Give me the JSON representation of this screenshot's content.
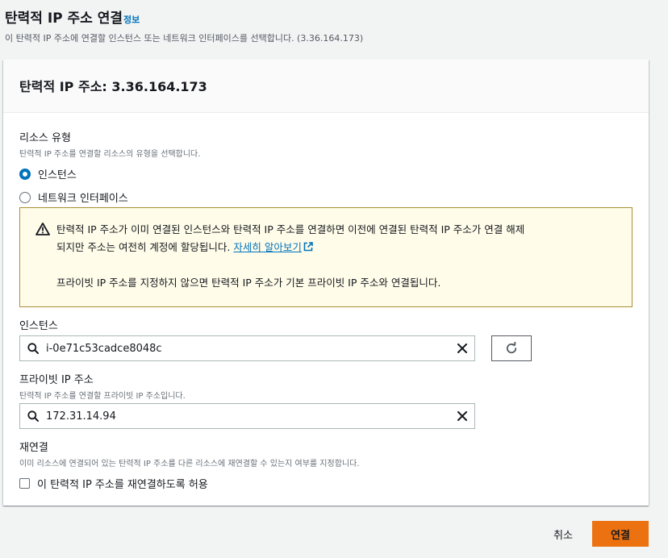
{
  "page": {
    "title": "탄력적 IP 주소 연결",
    "info_link": "정보",
    "description": "이 탄력적 IP 주소에 연결할 인스턴스 또는 네트워크 인터페이스를 선택합니다. (3.36.164.173)"
  },
  "panel": {
    "title": "탄력적 IP 주소: 3.36.164.173"
  },
  "resource_type": {
    "label": "리소스 유형",
    "description": "탄력적 IP 주소를 연결할 리소스의 유형을 선택합니다.",
    "options": [
      {
        "label": "인스턴스",
        "selected": true
      },
      {
        "label": "네트워크 인터페이스",
        "selected": false
      }
    ]
  },
  "warning": {
    "line1": "탄력적 IP 주소가 이미 연결된 인스턴스와 탄력적 IP 주소를 연결하면 이전에 연결된 탄력적 IP 주소가 연결 해제",
    "line2": "되지만 주소는 여전히 계정에 할당됩니다.",
    "learn_more": "자세히 알아보기",
    "line3": "프라이빗 IP 주소를 지정하지 않으면 탄력적 IP 주소가 기본 프라이빗 IP 주소와 연결됩니다."
  },
  "instance": {
    "label": "인스턴스",
    "value": "i-0e71c53cadce8048c"
  },
  "private_ip": {
    "label": "프라이빗 IP 주소",
    "description": "탄력적 IP 주소를 연결할 프라이빗 IP 주소입니다.",
    "value": "172.31.14.94"
  },
  "reassociation": {
    "label": "재연결",
    "description": "이미 리소스에 연결되어 있는 탄력적 IP 주소를 다른 리소스에 재연결할 수 있는지 여부를 지정합니다.",
    "checkbox_label": "이 탄력적 IP 주소를 재연결하도록 허용",
    "checked": false
  },
  "footer": {
    "cancel": "취소",
    "submit": "연결"
  },
  "colors": {
    "primary": "#ec7211",
    "link": "#0073bb",
    "warning_bg": "#fffce9",
    "warning_border": "#ab8f35"
  },
  "icons": [
    "warning-icon",
    "external-link-icon",
    "search-icon",
    "clear-icon",
    "refresh-icon"
  ]
}
